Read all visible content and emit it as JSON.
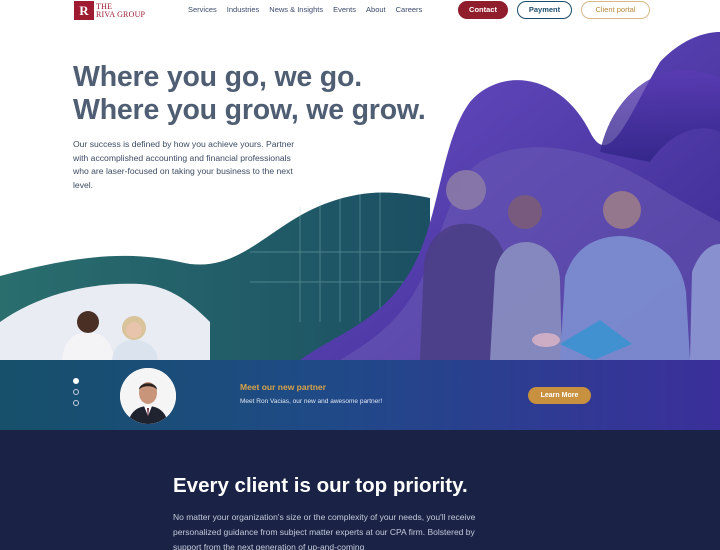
{
  "logo": {
    "mark": "R",
    "text_line1": "THE",
    "text_line2": "RIVA GROUP"
  },
  "nav": {
    "links": [
      "Services",
      "Industries",
      "News & Insights",
      "Events",
      "About",
      "Careers"
    ],
    "contact_label": "Contact",
    "payment_label": "Payment",
    "portal_label": "Client portal"
  },
  "hero": {
    "title_line1": "Where you go, we go.",
    "title_line2": "Where you grow, we grow.",
    "copy": "Our success is defined by how you achieve yours. Partner with accomplished accounting and financial professionals who are laser-focused on taking your business to the next level."
  },
  "partner": {
    "title": "Meet our new partner",
    "subtitle": "Meet Ron Vacias, our new and awesome partner!",
    "button_label": "Learn More",
    "slides": 3,
    "active_slide": 0
  },
  "priority": {
    "title": "Every client is our top priority.",
    "copy": "No matter your organization's size or the complexity of your needs, you'll receive personalized guidance from subject matter experts at our CPA firm. Bolstered by support from the next generation of up-and-coming"
  },
  "colors": {
    "brand_red": "#9e1b32",
    "heading_slate": "#4f5e73",
    "purple": "#4a2e9c",
    "teal": "#1d5b63",
    "gold": "#c8913f",
    "navy": "#1a2345"
  }
}
